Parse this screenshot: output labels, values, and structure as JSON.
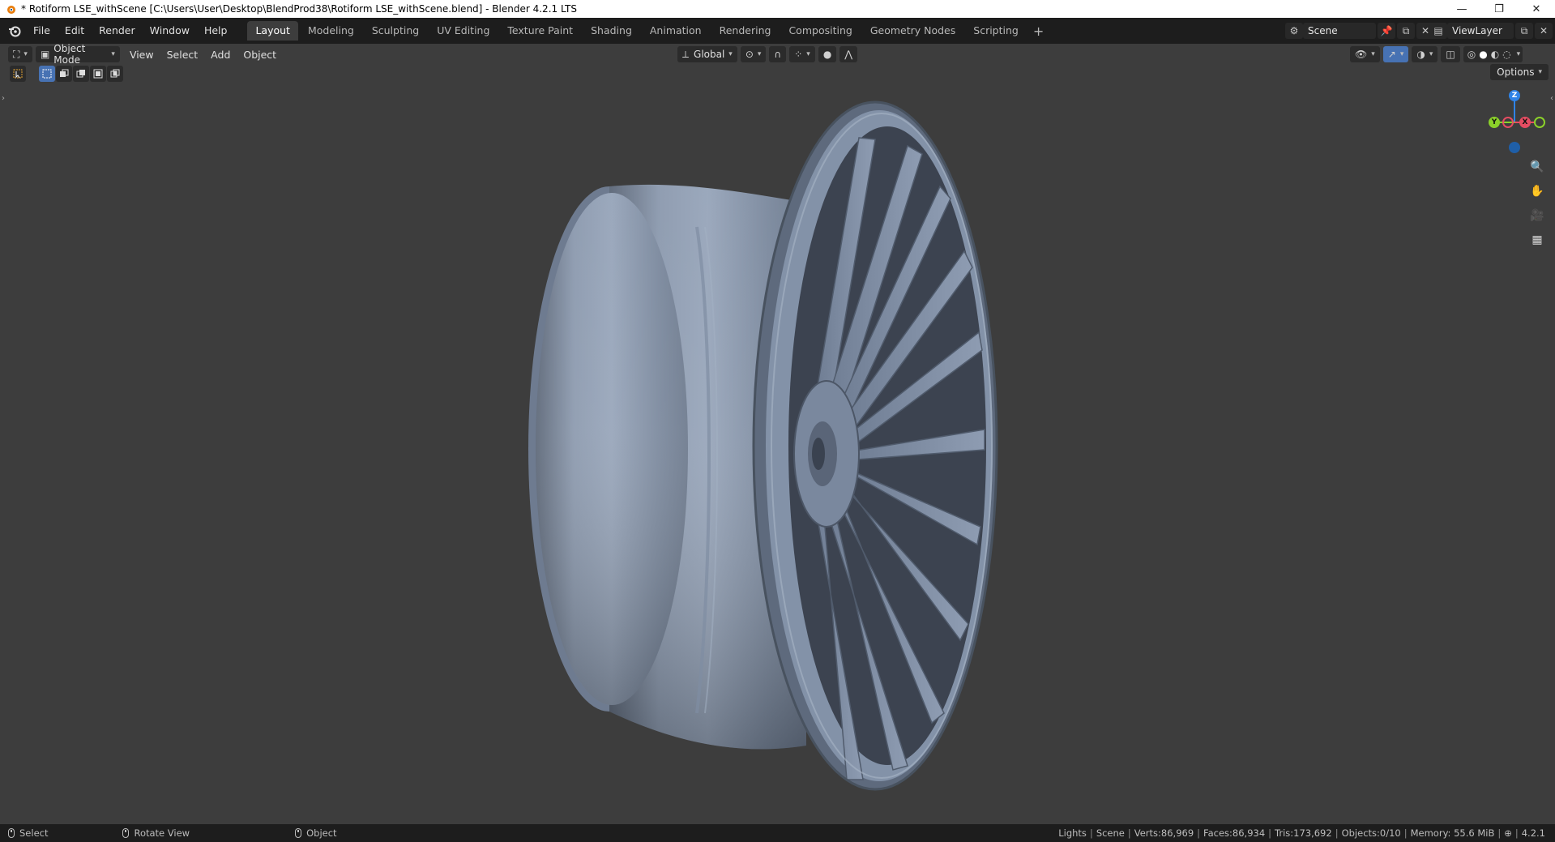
{
  "window": {
    "title": "* Rotiform LSE_withScene [C:\\Users\\User\\Desktop\\BlendProd38\\Rotiform LSE_withScene.blend] - Blender 4.2.1 LTS",
    "minimize": "—",
    "maximize": "❐",
    "close": "✕"
  },
  "menu": [
    "File",
    "Edit",
    "Render",
    "Window",
    "Help"
  ],
  "workspaces": [
    {
      "label": "Layout",
      "active": true
    },
    {
      "label": "Modeling"
    },
    {
      "label": "Sculpting"
    },
    {
      "label": "UV Editing"
    },
    {
      "label": "Texture Paint"
    },
    {
      "label": "Shading"
    },
    {
      "label": "Animation"
    },
    {
      "label": "Rendering"
    },
    {
      "label": "Compositing"
    },
    {
      "label": "Geometry Nodes"
    },
    {
      "label": "Scripting"
    }
  ],
  "workspace_add": "+",
  "scene": {
    "name": "Scene"
  },
  "view_layer": {
    "name": "ViewLayer"
  },
  "viewport_header": {
    "mode": "Object Mode",
    "menus": [
      "View",
      "Select",
      "Add",
      "Object"
    ],
    "orientation": "Global"
  },
  "options_label": "Options",
  "gizmo": {
    "x": "X",
    "y": "Y",
    "z": "Z"
  },
  "colors": {
    "accent": "#4772b3",
    "axis_x": "#e54d62",
    "axis_y": "#8bd12a",
    "axis_z": "#2f83e7",
    "wheel": "#8d9bb0",
    "background": "#3d3d3d"
  },
  "status": {
    "left": [
      {
        "label": "Select"
      },
      {
        "label": "Rotate View"
      },
      {
        "label": "Object"
      }
    ],
    "stats": {
      "collection": "Lights",
      "scene": "Scene",
      "verts": "Verts:86,969",
      "faces": "Faces:86,934",
      "tris": "Tris:173,692",
      "objects": "Objects:0/10",
      "memory": "Memory: 55.6 MiB",
      "version": "4.2.1"
    }
  }
}
